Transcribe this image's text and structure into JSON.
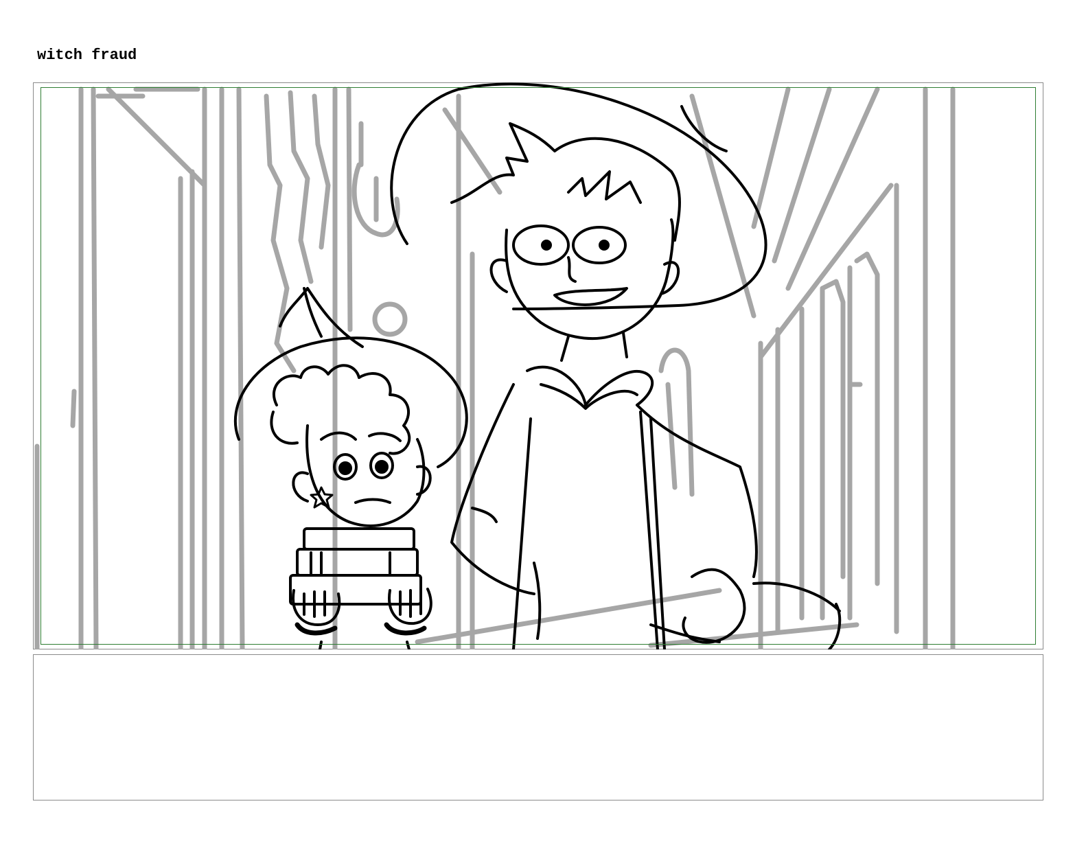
{
  "scene": {
    "title": "witch fraud"
  },
  "panel": {
    "description_visible": false,
    "colors": {
      "safe_frame": "#2e7d32",
      "border": "#8a8a8a",
      "background_sketch": "#a6a6a6",
      "character_line": "#000000"
    }
  },
  "notes": {
    "text": ""
  }
}
